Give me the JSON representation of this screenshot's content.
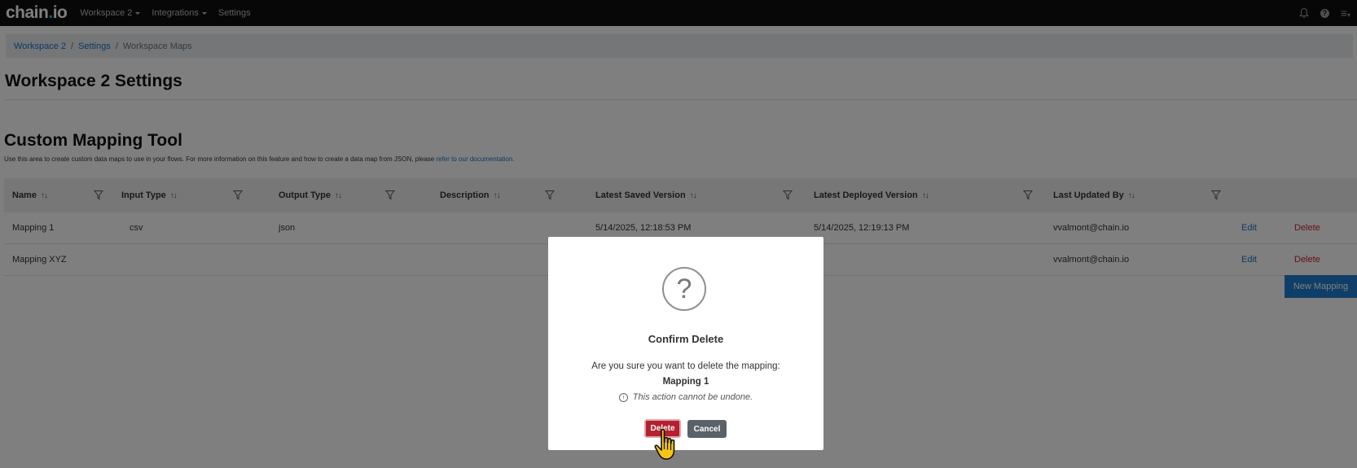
{
  "topbar": {
    "logo_main": "chain",
    "logo_dot": ".",
    "logo_tail": "io",
    "nav": [
      {
        "label": "Workspace 2",
        "dropdown": true
      },
      {
        "label": "Integrations",
        "dropdown": true
      },
      {
        "label": "Settings",
        "dropdown": false
      }
    ],
    "icons": [
      "bell-icon",
      "help-icon",
      "menu-icon"
    ],
    "help_glyph": "?",
    "menu_glyph": "≡"
  },
  "breadcrumb": {
    "items": [
      {
        "label": "Workspace 2",
        "link": true
      },
      {
        "label": "Settings",
        "link": true
      },
      {
        "label": "Workspace Maps",
        "link": false
      }
    ],
    "separator": "/"
  },
  "page_title": "Workspace 2 Settings",
  "section": {
    "title": "Custom Mapping Tool",
    "description": "Use this area to create custom data maps to use in your flows. For more information on this feature and how to create a data map from JSON, please ",
    "doc_link": "refer to our documentation",
    "desc_end": "."
  },
  "table": {
    "sort_glyph": "↑↓",
    "columns": [
      "Name",
      "Input Type",
      "Output Type",
      "Description",
      "Latest Saved Version",
      "Latest Deployed Version",
      "Last Updated By"
    ],
    "rows": [
      {
        "name": "Mapping 1",
        "input": "csv",
        "output": "json",
        "description": "",
        "saved": "5/14/2025, 12:18:53 PM",
        "deployed": "5/14/2025, 12:19:13 PM",
        "updated_by": "vvalmont@chain.io",
        "edit": "Edit",
        "delete": "Delete"
      },
      {
        "name": "Mapping XYZ",
        "input": "",
        "output": "",
        "description": "",
        "saved": "",
        "deployed": "",
        "updated_by": "vvalmont@chain.io",
        "edit": "Edit",
        "delete": "Delete"
      }
    ]
  },
  "new_mapping_label": "New Mapping",
  "modal": {
    "icon_glyph": "?",
    "title": "Confirm Delete",
    "message": "Are you sure you want to delete the mapping:",
    "mapping_name": "Mapping 1",
    "info_glyph": "i",
    "warning": "This action cannot be undone.",
    "delete_label": "Delete",
    "cancel_label": "Cancel"
  },
  "colors": {
    "topbar_bg": "#0e0e0e",
    "link": "#1a73c9",
    "delete": "#c82333",
    "primary_button": "#1e7fd0",
    "danger_button": "#b51f2e",
    "secondary_button": "#5a6268"
  }
}
